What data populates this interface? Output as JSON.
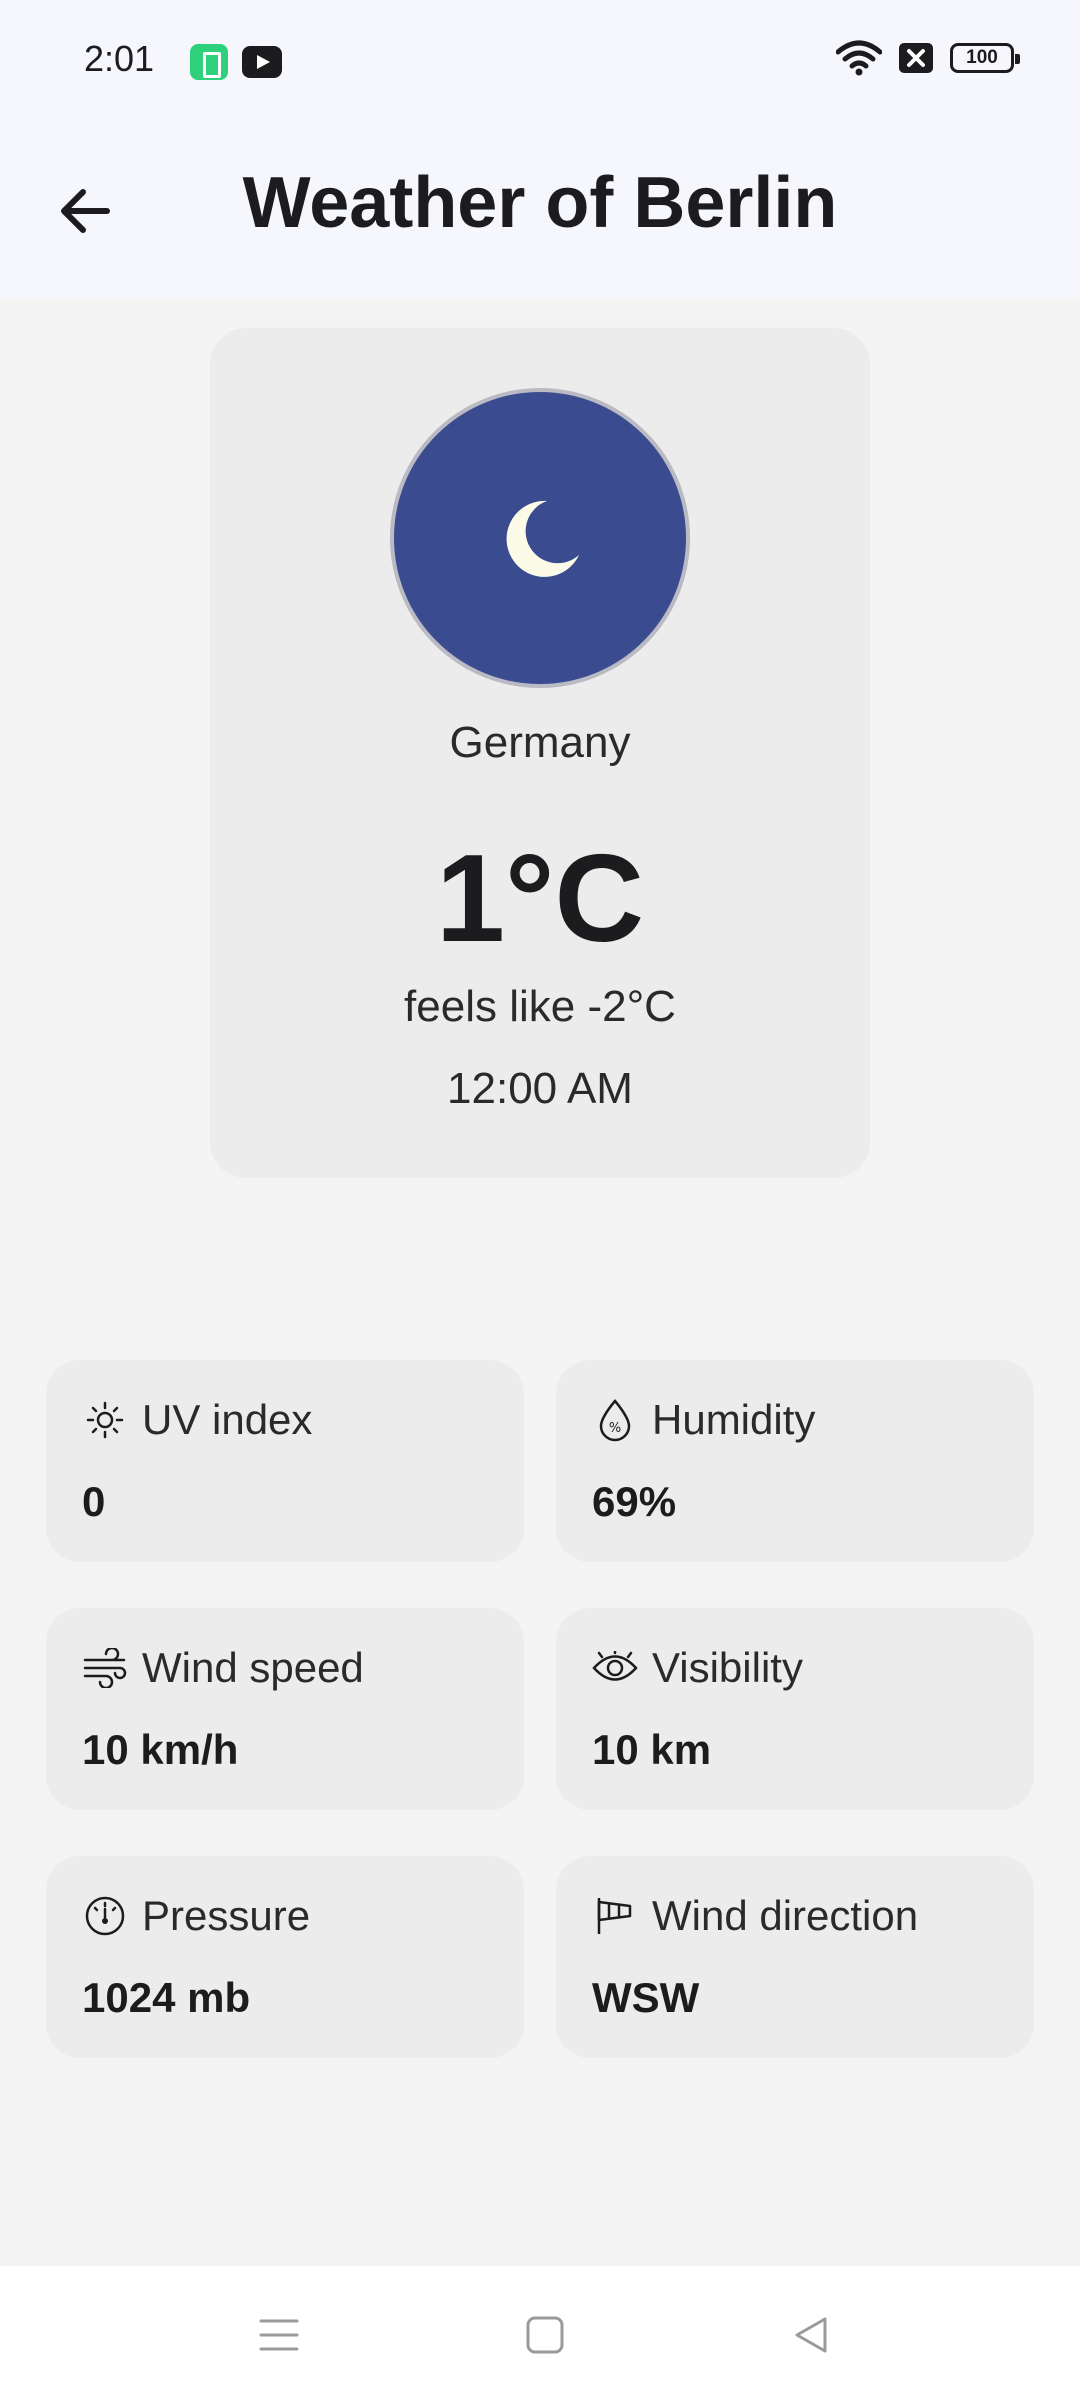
{
  "status_bar": {
    "time": "2:01",
    "battery_level": "100",
    "icons": [
      "battery-saver-icon",
      "youtube-icon",
      "wifi-icon",
      "no-sim-icon",
      "battery-icon"
    ]
  },
  "header": {
    "title": "Weather of Berlin",
    "back_icon": "arrow-left-icon"
  },
  "current": {
    "condition_icon": "moon-icon",
    "country": "Germany",
    "temperature": "1°C",
    "feels_like": "feels like -2°C",
    "time": "12:00 AM"
  },
  "stats": [
    {
      "label": "UV index",
      "value": "0",
      "icon": "sun-icon"
    },
    {
      "label": "Humidity",
      "value": "69%",
      "icon": "humidity-drop-icon"
    },
    {
      "label": "Wind speed",
      "value": "10 km/h",
      "icon": "wind-icon"
    },
    {
      "label": "Visibility",
      "value": "10 km",
      "icon": "eye-icon"
    },
    {
      "label": "Pressure",
      "value": "1024 mb",
      "icon": "gauge-icon"
    },
    {
      "label": "Wind direction",
      "value": "WSW",
      "icon": "windsock-icon"
    }
  ],
  "nav": {
    "icons": [
      "menu-icon",
      "home-square-icon",
      "back-triangle-icon"
    ]
  },
  "colors": {
    "weather_circle": "#3b4b8f",
    "card_bg": "#ececec",
    "page_bg": "#f4f4f4",
    "header_bg": "#f6f7fc"
  }
}
